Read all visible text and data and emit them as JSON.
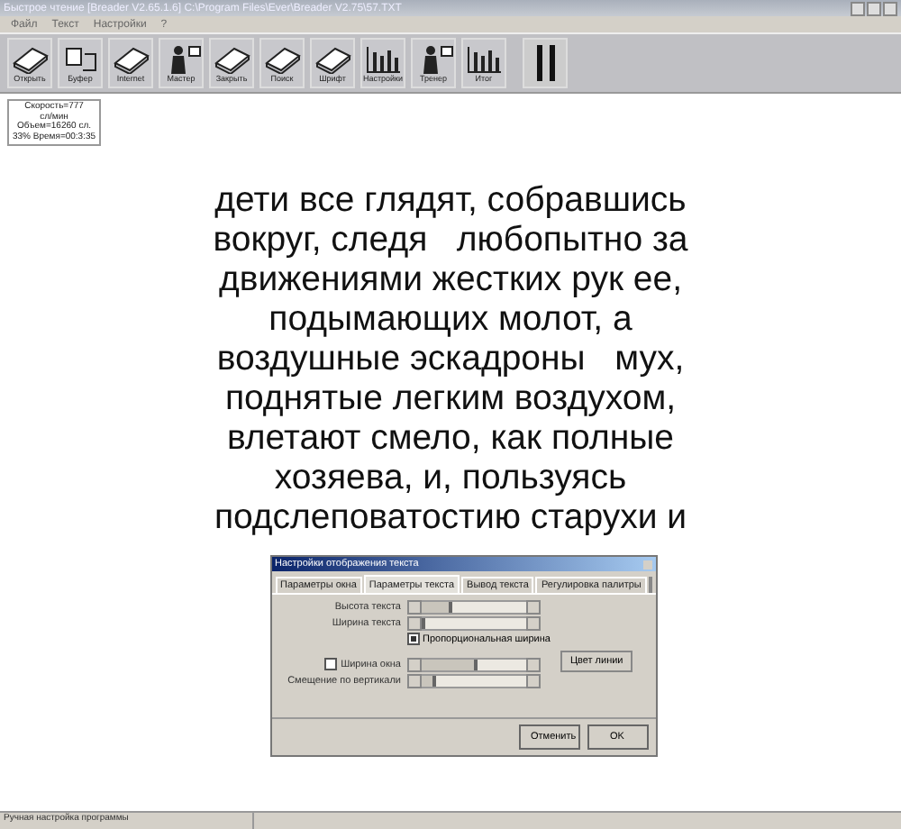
{
  "window": {
    "title": "Быстрое чтение [Breader V2.65.1.6] C:\\Program Files\\Ever\\Breader V2.75\\57.TXT"
  },
  "menu": [
    "Файл",
    "Текст",
    "Настройки",
    "?"
  ],
  "toolbar": [
    {
      "label": "Открыть",
      "kind": "book"
    },
    {
      "label": "Буфер",
      "kind": "clipboard"
    },
    {
      "label": "Internet",
      "kind": "book"
    },
    {
      "label": "Мастер",
      "kind": "person"
    },
    {
      "label": "Закрыть",
      "kind": "book"
    },
    {
      "label": "Поиск",
      "kind": "book"
    },
    {
      "label": "Шрифт",
      "kind": "book"
    },
    {
      "label": "Настройки",
      "kind": "chart"
    },
    {
      "label": "Тренер",
      "kind": "person"
    },
    {
      "label": "Итог",
      "kind": "chart"
    }
  ],
  "info_box": [
    "Скорость=777",
    "сл/мин",
    "Объем=16260 сл.",
    "33% Время=00:3:35"
  ],
  "reading_text": [
    "дети все глядят, собравшись",
    "вокруг, следя   любопытно за",
    "движениями жестких рук ее,",
    "подымающих молот, а",
    "воздушные эскадроны   мух,",
    "поднятые легким воздухом,",
    "влетают смело, как полные",
    "хозяева, и, пользуясь",
    "подслеповатостию старухи и"
  ],
  "dialog": {
    "title": "Настройки отображения текста",
    "tabs": [
      {
        "label": "Параметры окна",
        "selected": false
      },
      {
        "label": "Параметры текста",
        "selected": true
      },
      {
        "label": "Вывод текста",
        "selected": false
      },
      {
        "label": "Регулировка палитры",
        "selected": false
      }
    ],
    "rows": [
      {
        "kind": "slider",
        "label": "Высота текста",
        "level": 0.3
      },
      {
        "kind": "slider",
        "label": "Ширина текста",
        "level": 0.05
      },
      {
        "kind": "checkbox",
        "label": "Пропорциональная ширина",
        "checked": true
      },
      {
        "kind": "check-slider",
        "label": "Ширина окна",
        "checked": false,
        "level": 0.55
      },
      {
        "kind": "slider",
        "label": "Смещение по вертикали",
        "level": 0.15
      }
    ],
    "color_button": "Цвет линии",
    "buttons": [
      "Отменить",
      "OK"
    ]
  },
  "status_bar": [
    "Ручная настройка программы"
  ]
}
